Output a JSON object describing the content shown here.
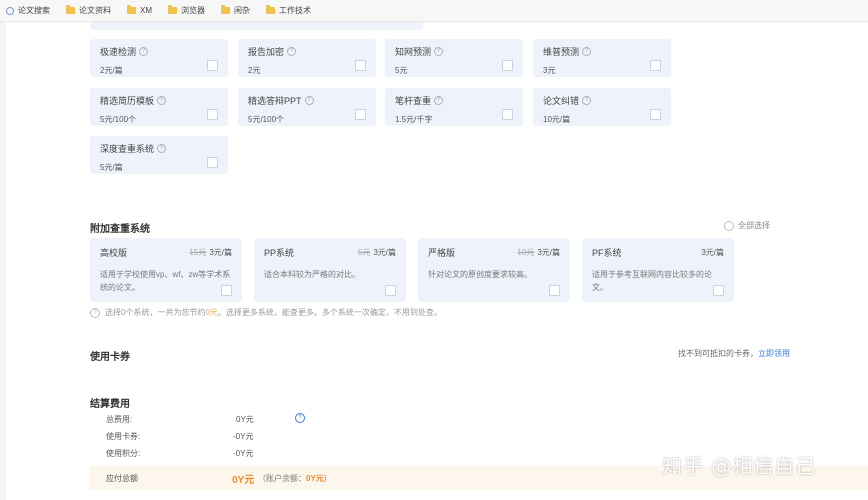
{
  "bookmarks": [
    {
      "label": "论文搜索",
      "icon": "globe-icon"
    },
    {
      "label": "论文资料",
      "icon": "folder-icon"
    },
    {
      "label": "XM",
      "icon": "folder-icon"
    },
    {
      "label": "浏览器",
      "icon": "folder-icon"
    },
    {
      "label": "闲杂",
      "icon": "folder-icon"
    },
    {
      "label": "工作技术",
      "icon": "folder-icon"
    }
  ],
  "services": [
    {
      "name": "极速检测",
      "price": "2元/篇"
    },
    {
      "name": "报告加密",
      "price": "2元"
    },
    {
      "name": "知网预测",
      "price": "5元"
    },
    {
      "name": "维普预测",
      "price": "3元"
    },
    {
      "name": "精选简历模板",
      "price": "5元/100个"
    },
    {
      "name": "精选答辩PPT",
      "price": "5元/100个"
    },
    {
      "name": "笔杆查重",
      "price": "1.5元/千字"
    },
    {
      "name": "论文纠错",
      "price": "10元/篇"
    },
    {
      "name": "深度查重系统",
      "price": "5元/篇"
    }
  ],
  "additional": {
    "title": "附加查重系统",
    "select_all": "全部选择",
    "systems": [
      {
        "name": "高校版",
        "orig": "15元",
        "price": "3元/篇",
        "desc": "适用于学校使用vp、wf、zw等学术系统的论文。"
      },
      {
        "name": "PP系统",
        "orig": "5元",
        "price": "3元/篇",
        "desc": "适合本科较为严格的对比。"
      },
      {
        "name": "严格版",
        "orig": "10元",
        "price": "3元/篇",
        "desc": "针对论文的原创度要求较高。"
      },
      {
        "name": "PF系统",
        "orig": "",
        "price": "3元/篇",
        "desc": "适用于参考互联网内容比较多的论文。"
      }
    ],
    "hint_pre": "选择0个系统，一共为您节约",
    "hint_amount": "0元",
    "hint_post": "。选择更多系统，能查更多。多个系统一次确定，不用到处查。"
  },
  "coupon": {
    "title": "使用卡券",
    "right_text": "找不到可抵扣的卡券，",
    "link": "立即领用"
  },
  "settlement": {
    "title": "结算费用",
    "rows": [
      {
        "label": "总费用:",
        "value": "0Y元"
      },
      {
        "label": "使用卡券:",
        "value": "-0Y元"
      },
      {
        "label": "使用积分:",
        "value": "-0Y元"
      }
    ],
    "help": "?",
    "payable_label": "应付总额",
    "payable_amount": "0Y元",
    "balance_pre": "（账户余额：",
    "balance_amount": "0Y元",
    "balance_post": "）"
  },
  "watermark": "知乎 @相信自己",
  "colors": {
    "card": "#eef3fb",
    "accent": "#f08a2b",
    "link": "#3d7ee0"
  }
}
